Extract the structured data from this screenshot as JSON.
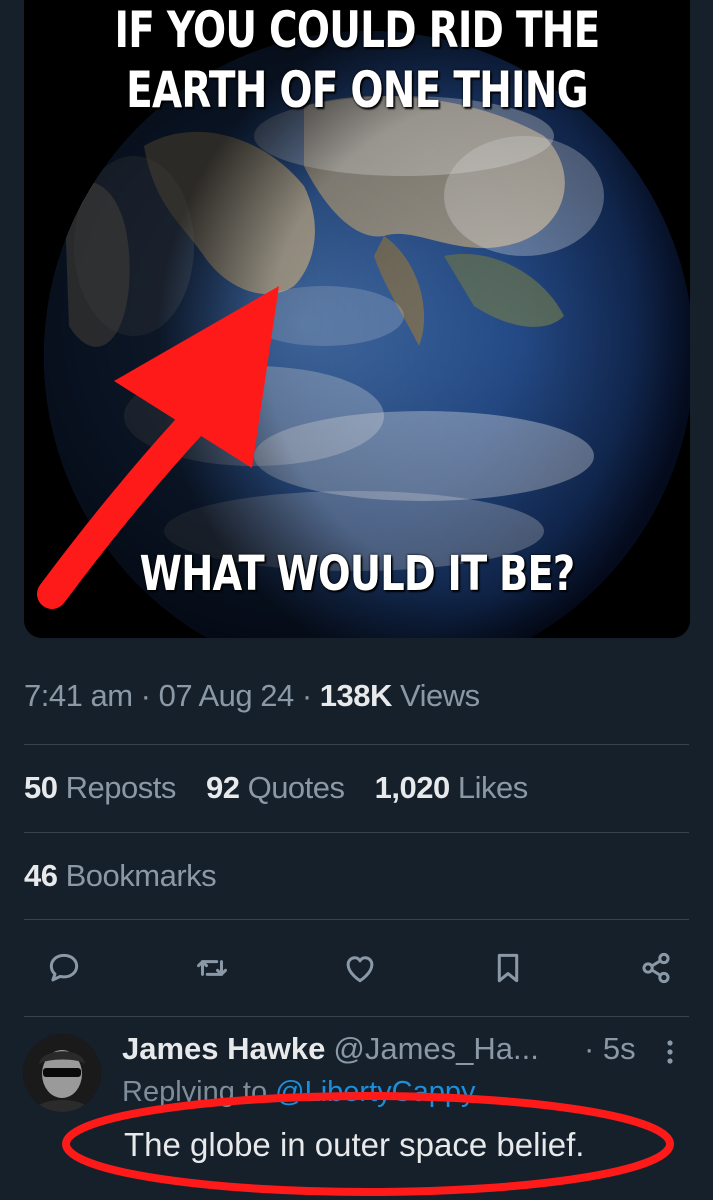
{
  "meme": {
    "line1": "IF YOU COULD RID THE",
    "line2": "EARTH OF ONE THING",
    "bottom": "WHAT WOULD IT BE?"
  },
  "meta": {
    "time": "7:41 am",
    "date": "07 Aug 24",
    "views_count": "138K",
    "views_label": "Views"
  },
  "stats": {
    "reposts_count": "50",
    "reposts_label": "Reposts",
    "quotes_count": "92",
    "quotes_label": "Quotes",
    "likes_count": "1,020",
    "likes_label": "Likes",
    "bookmarks_count": "46",
    "bookmarks_label": "Bookmarks"
  },
  "actions": [
    "reply-icon",
    "repost-icon",
    "like-icon",
    "bookmark-icon",
    "share-icon"
  ],
  "reply": {
    "name": "James Hawke",
    "handle": "@James_Ha...",
    "time": "· 5s",
    "replying_prefix": "Replying to",
    "replying_handle": "@LibertyCappy",
    "text": "The globe in outer space belief."
  },
  "colors": {
    "background": "#15202b",
    "annotation_red": "#ff1a1a",
    "link_blue": "#1d9bf0",
    "muted": "#8b98a5"
  }
}
